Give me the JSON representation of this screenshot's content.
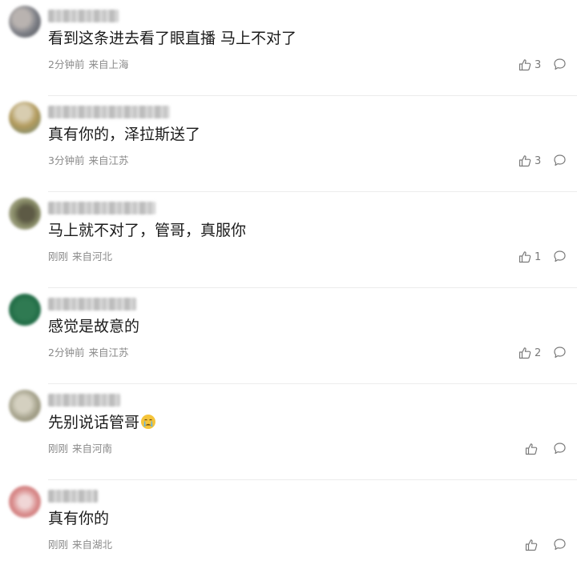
{
  "comments": [
    {
      "text": "看到这条进去看了眼直播 马上不对了",
      "time": "2分钟前",
      "location": "来自上海",
      "likes": "3",
      "avatar_colors": [
        "#7d7f86",
        "#b9b3b0",
        "#4a4c52"
      ]
    },
    {
      "text": "真有你的，泽拉斯送了",
      "time": "3分钟前",
      "location": "来自江苏",
      "likes": "3",
      "avatar_colors": [
        "#b29a5c",
        "#6f8a7a",
        "#d8cdb0"
      ]
    },
    {
      "text": "马上就不对了，管哥，真服你",
      "time": "刚刚",
      "location": "来自河北",
      "likes": "1",
      "avatar_colors": [
        "#5d5a45",
        "#c7c4b3",
        "#8b8f6a"
      ]
    },
    {
      "text": "感觉是故意的",
      "time": "2分钟前",
      "location": "来自江苏",
      "likes": "2",
      "avatar_colors": [
        "#1e6a44",
        "#2f7a52",
        "#1a5a3a"
      ]
    },
    {
      "text": "先别说话管哥",
      "emoji": "crying-face-emoji",
      "time": "刚刚",
      "location": "来自河南",
      "likes": "",
      "avatar_colors": [
        "#a9a690",
        "#d4d0c0",
        "#7f7a60"
      ]
    },
    {
      "text": "真有你的",
      "time": "刚刚",
      "location": "来自湖北",
      "likes": "",
      "avatar_colors": [
        "#d98c8c",
        "#f0d6d6",
        "#c46a6a"
      ]
    }
  ],
  "icons": {
    "like": "thumbs-up-icon",
    "reply": "speech-bubble-icon"
  }
}
